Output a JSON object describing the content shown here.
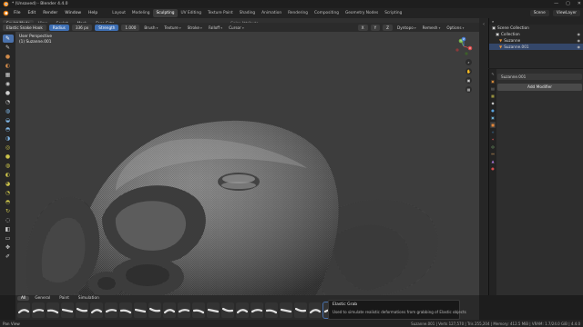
{
  "window": {
    "title": "* (Unsaved) - Blender 4.4.0",
    "controls": [
      "—",
      "▢",
      "✕"
    ]
  },
  "menubar": {
    "items": [
      "File",
      "Edit",
      "Render",
      "Window",
      "Help"
    ],
    "workspaces": [
      "Layout",
      "Modeling",
      "Sculpting",
      "UV Editing",
      "Texture Paint",
      "Shading",
      "Animation",
      "Rendering",
      "Compositing",
      "Geometry Nodes",
      "Scripting"
    ],
    "active_workspace": "Sculpting",
    "scene": "Scene",
    "view_layer": "ViewLayer"
  },
  "header": {
    "mode": "Sculpt Mode",
    "menus": [
      "View",
      "Sculpt",
      "Mask",
      "Face Sets"
    ],
    "center_info": "Color Attribute",
    "transform": "Global",
    "overlays": [
      "X",
      "Y",
      "Z"
    ],
    "right_menus": [
      "Dyntopo",
      "Remesh",
      "Options"
    ]
  },
  "tool_settings": {
    "brush": "Elastic Snake Hook",
    "radius_label": "Radius",
    "radius_value": "336 px",
    "strength_label": "Strength",
    "strength_value": "1.000",
    "menus": [
      "Brush",
      "Texture",
      "Stroke",
      "Falloff",
      "Cursor"
    ]
  },
  "viewport": {
    "perspective": "User Perspective",
    "object": "(1) Suzanne.001",
    "gizmo": {
      "x_color": "#d94b4b",
      "y_color": "#7ab648",
      "z_color": "#4a7fd6",
      "x": "X",
      "y": "Y",
      "z": "Z"
    }
  },
  "tools": [
    "draw-icon",
    "draw-sharp-icon",
    "clay-icon",
    "clay-strips-icon",
    "layer-icon",
    "inflate-icon",
    "blob-icon",
    "crease-icon",
    "smooth-icon",
    "flatten-icon",
    "fill-icon",
    "scrape-icon",
    "pinch-icon",
    "grab-icon",
    "elastic-grab-icon",
    "snake-hook-icon",
    "thumb-icon",
    "pose-icon",
    "nudge-icon",
    "rotate-icon",
    "slide-relax-icon",
    "mask-icon",
    "box-mask-icon",
    "transform-icon",
    "annotate-icon"
  ],
  "outliner": {
    "scene_collection": "Scene Collection",
    "collection": "Collection",
    "items": [
      "Suzanne",
      "Suzanne.001"
    ],
    "selected": "Suzanne.001"
  },
  "properties": {
    "object_name": "Suzanne.001",
    "add_modifier": "Add Modifier",
    "tab_colors": [
      "#888888",
      "#d48a3c",
      "#8a8a8a",
      "#c9c14a",
      "#d0d0d0",
      "#5aa5e0",
      "#6fb1d6",
      "#e0853a",
      "#4aa3e6",
      "#c04f4f",
      "#88c07a",
      "#d6a060",
      "#a574d1",
      "#d34b4b"
    ]
  },
  "asset_shelf": {
    "tabs": [
      "All",
      "General",
      "Paint",
      "Simulation"
    ],
    "active_tab": "All",
    "brush_count": 22
  },
  "tooltip": {
    "title": "Elastic Grab",
    "description": "Used to simulate realistic deformations from grabbing of Elastic objects"
  },
  "statusbar": {
    "left": "Pan View",
    "right": "Suzanne.001 | Verts 127,570 | Tris 255,204 | Memory: 412.5 MiB | VRAM: 1.7/24.0 GiB | 4.4.0"
  }
}
